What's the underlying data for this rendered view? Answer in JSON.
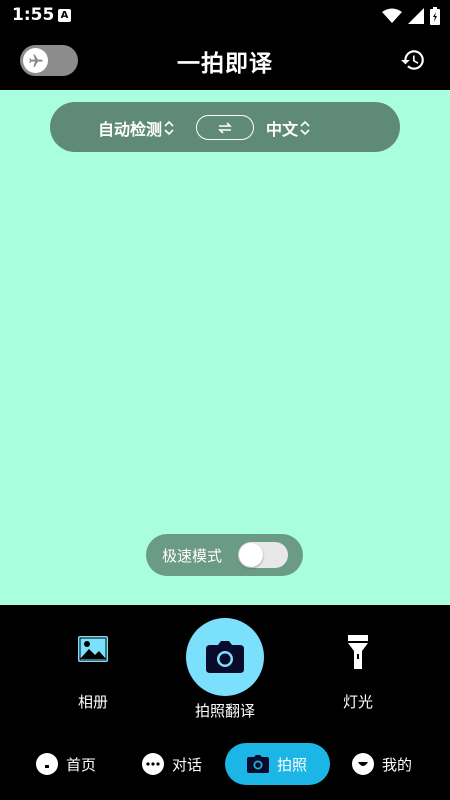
{
  "status_bar": {
    "time": "1:55",
    "notification_icon": "A"
  },
  "header": {
    "title": "一拍即译",
    "airplane_toggle_icon": "airplane-icon",
    "history_icon": "history-icon"
  },
  "language_bar": {
    "source_language": "自动检测",
    "target_language": "中文",
    "swap_icon": "swap-icon"
  },
  "speed_mode": {
    "label": "极速模式",
    "enabled": false
  },
  "camera_controls": {
    "album_label": "相册",
    "shutter_label": "拍照翻译",
    "light_label": "灯光"
  },
  "bottom_nav": {
    "items": [
      {
        "label": "首页",
        "icon": "home-icon"
      },
      {
        "label": "对话",
        "icon": "chat-icon"
      },
      {
        "label": "拍照",
        "icon": "camera-icon",
        "active": true
      },
      {
        "label": "我的",
        "icon": "profile-icon"
      }
    ]
  },
  "colors": {
    "preview_bg": "#a8fede",
    "pill_bg": "#5e8a77",
    "shutter_bg": "#7be0fb",
    "nav_active_bg": "#1bb6e6"
  }
}
